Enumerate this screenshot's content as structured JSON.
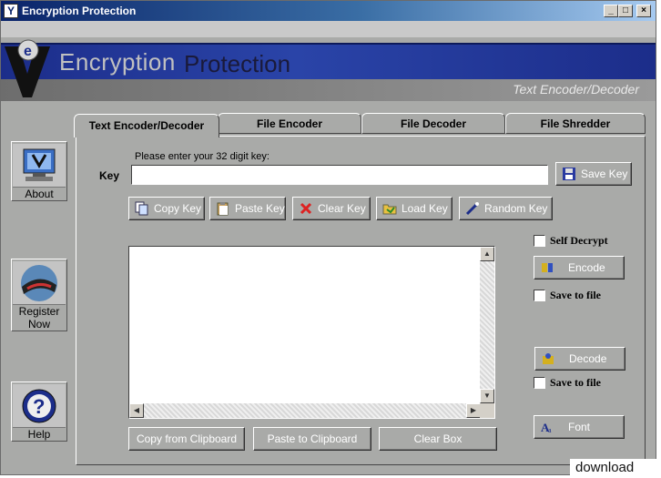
{
  "window": {
    "title": "Encryption Protection",
    "app_icon": "Y"
  },
  "header": {
    "brand_part1": "Encryption",
    "brand_part2": "Protection",
    "subtitle": "Text Encoder/Decoder"
  },
  "sidebar": {
    "about": "About",
    "register_line1": "Register",
    "register_line2": "Now",
    "help": "Help"
  },
  "tabs": [
    {
      "label": "Text Encoder/Decoder",
      "active": true
    },
    {
      "label": "File Encoder",
      "active": false
    },
    {
      "label": "File Decoder",
      "active": false
    },
    {
      "label": "File Shredder",
      "active": false
    }
  ],
  "key_section": {
    "prompt": "Please enter your 32 digit key:",
    "label": "Key",
    "value": "",
    "save_key": "Save Key"
  },
  "key_buttons": {
    "copy": "Copy Key",
    "paste": "Paste Key",
    "clear": "Clear Key",
    "load": "Load Key",
    "random": "Random Key"
  },
  "text_box": {
    "value": ""
  },
  "bottom_buttons": {
    "copy_from": "Copy from Clipboard",
    "paste_to": "Paste to Clipboard",
    "clear_box": "Clear Box"
  },
  "right_panel": {
    "self_decrypt": "Self Decrypt",
    "encode": "Encode",
    "save_to_file_1": "Save to file",
    "decode": "Decode",
    "save_to_file_2": "Save to file",
    "font": "Font"
  },
  "watermark": "download",
  "colors": {
    "window_bg": "#a9aaa8",
    "banner_blue": "#1c2d8a",
    "title_bar": "#0a246a"
  }
}
